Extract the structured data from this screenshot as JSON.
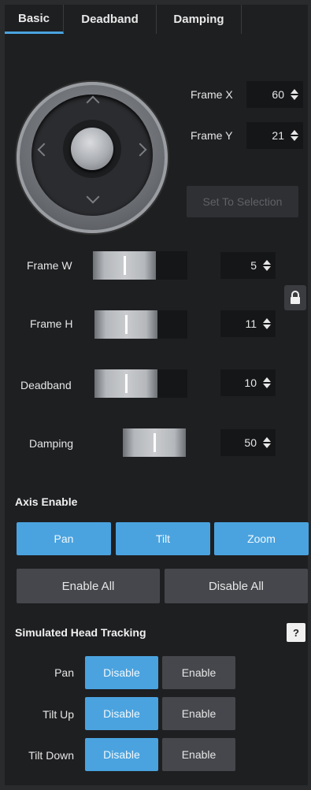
{
  "tabs": [
    {
      "label": "Basic",
      "active": true
    },
    {
      "label": "Deadband",
      "active": false
    },
    {
      "label": "Damping",
      "active": false
    }
  ],
  "frame_x": {
    "label": "Frame X",
    "value": "60"
  },
  "frame_y": {
    "label": "Frame Y",
    "value": "21"
  },
  "set_to_selection": "Set To Selection",
  "sliders": [
    {
      "label": "Frame W",
      "value": "5",
      "level": 0.66
    },
    {
      "label": "Frame H",
      "value": "11",
      "level": 0.66
    },
    {
      "label": "Deadband",
      "value": "10",
      "level": 0.66
    },
    {
      "label": "Damping",
      "value": "50",
      "level": 1.0
    }
  ],
  "axis_enable": {
    "title": "Axis Enable",
    "buttons": [
      "Pan",
      "Tilt",
      "Zoom"
    ],
    "enable_all": "Enable All",
    "disable_all": "Disable All"
  },
  "head_tracking": {
    "title": "Simulated Head Tracking",
    "help": "?",
    "rows": [
      {
        "label": "Pan",
        "disable": "Disable",
        "enable": "Enable"
      },
      {
        "label": "Tilt Up",
        "disable": "Disable",
        "enable": "Enable"
      },
      {
        "label": "Tilt Down",
        "disable": "Disable",
        "enable": "Enable"
      }
    ]
  },
  "colors": {
    "accent": "#4aa3df",
    "panel": "#1e1f21",
    "background": "#2a2b2d"
  }
}
